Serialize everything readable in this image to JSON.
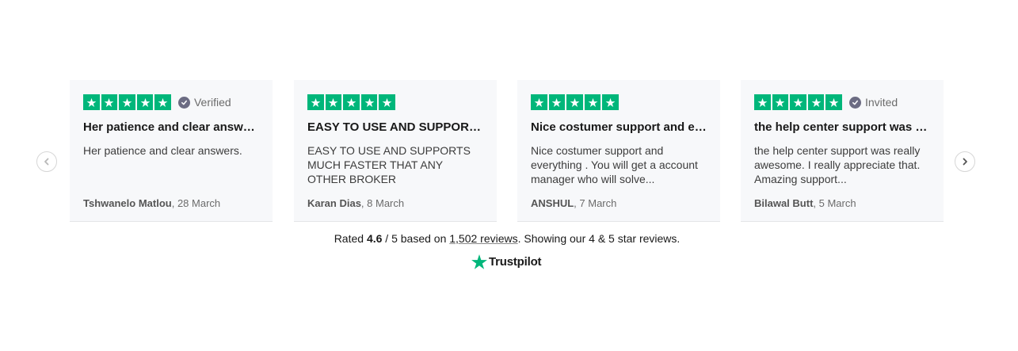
{
  "colors": {
    "star_green": "#00b67a",
    "card_bg": "#f7f8fa",
    "verified_badge": "#6c6c83"
  },
  "navigation": {
    "prev_icon": "chevron-left-icon",
    "next_icon": "chevron-right-icon"
  },
  "reviews": [
    {
      "rating": 5,
      "badge": "Verified",
      "title": "Her patience and clear answers.",
      "body": "Her patience and clear answers.",
      "author": "Tshwanelo Matlou",
      "date": "28 March"
    },
    {
      "rating": 5,
      "badge": "",
      "title": "EASY TO USE AND SUPPORTS MUCH FASTER THAT ANY OTHER BROKER",
      "body": "EASY TO USE AND SUPPORTS MUCH FASTER THAT ANY OTHER BROKER",
      "author": "Karan Dias",
      "date": "8 March"
    },
    {
      "rating": 5,
      "badge": "",
      "title": "Nice costumer support and everything",
      "body": "Nice costumer support and everything . You will get a account manager who will solve...",
      "author": "ANSHUL",
      "date": "7 March"
    },
    {
      "rating": 5,
      "badge": "Invited",
      "title": "the help center support was really awesome",
      "body": "the help center support was really awesome. I really appreciate that. Amazing support...",
      "author": "Bilawal Butt",
      "date": "5 March"
    }
  ],
  "summary": {
    "prefix": "Rated ",
    "rating": "4.6",
    "out_of": " / 5 based on ",
    "review_count_link": "1,502 reviews",
    "suffix": ". Showing our 4 & 5 star reviews."
  },
  "brand": {
    "name": "Trustpilot",
    "icon": "trustpilot-star-icon"
  }
}
